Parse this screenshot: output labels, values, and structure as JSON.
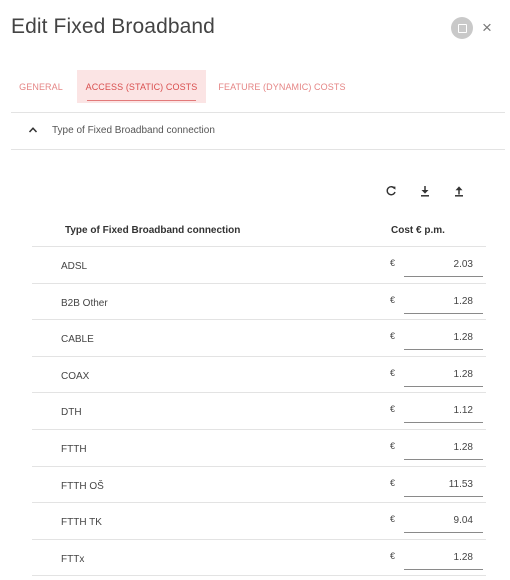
{
  "dialog": {
    "title": "Edit Fixed Broadband",
    "close_symbol": "×"
  },
  "tabs": [
    {
      "label": "GENERAL",
      "active": false
    },
    {
      "label": "ACCESS (STATIC) COSTS",
      "active": true
    },
    {
      "label": "FEATURE (DYNAMIC) COSTS",
      "active": false
    }
  ],
  "section": {
    "label": "Type of Fixed Broadband connection",
    "expanded": true
  },
  "toolbar": {
    "icons": [
      "refresh-icon",
      "download-icon",
      "upload-icon"
    ]
  },
  "table": {
    "columns": {
      "type": "Type of Fixed Broadband connection",
      "cost": "Cost € p.m."
    },
    "currency_symbol": "€",
    "rows": [
      {
        "name": "ADSL",
        "cost": "2.03"
      },
      {
        "name": "B2B Other",
        "cost": "1.28"
      },
      {
        "name": "CABLE",
        "cost": "1.28"
      },
      {
        "name": "COAX",
        "cost": "1.28"
      },
      {
        "name": "DTH",
        "cost": "1.12"
      },
      {
        "name": "FTTH",
        "cost": "1.28"
      },
      {
        "name": "FTTH OŠ",
        "cost": "11.53"
      },
      {
        "name": "FTTH TK",
        "cost": "9.04"
      },
      {
        "name": "FTTx",
        "cost": "1.28"
      }
    ]
  },
  "colors": {
    "accent": "#e27a7a",
    "tab_active_bg": "#fbe4e4",
    "divider": "#e3e3e3"
  }
}
